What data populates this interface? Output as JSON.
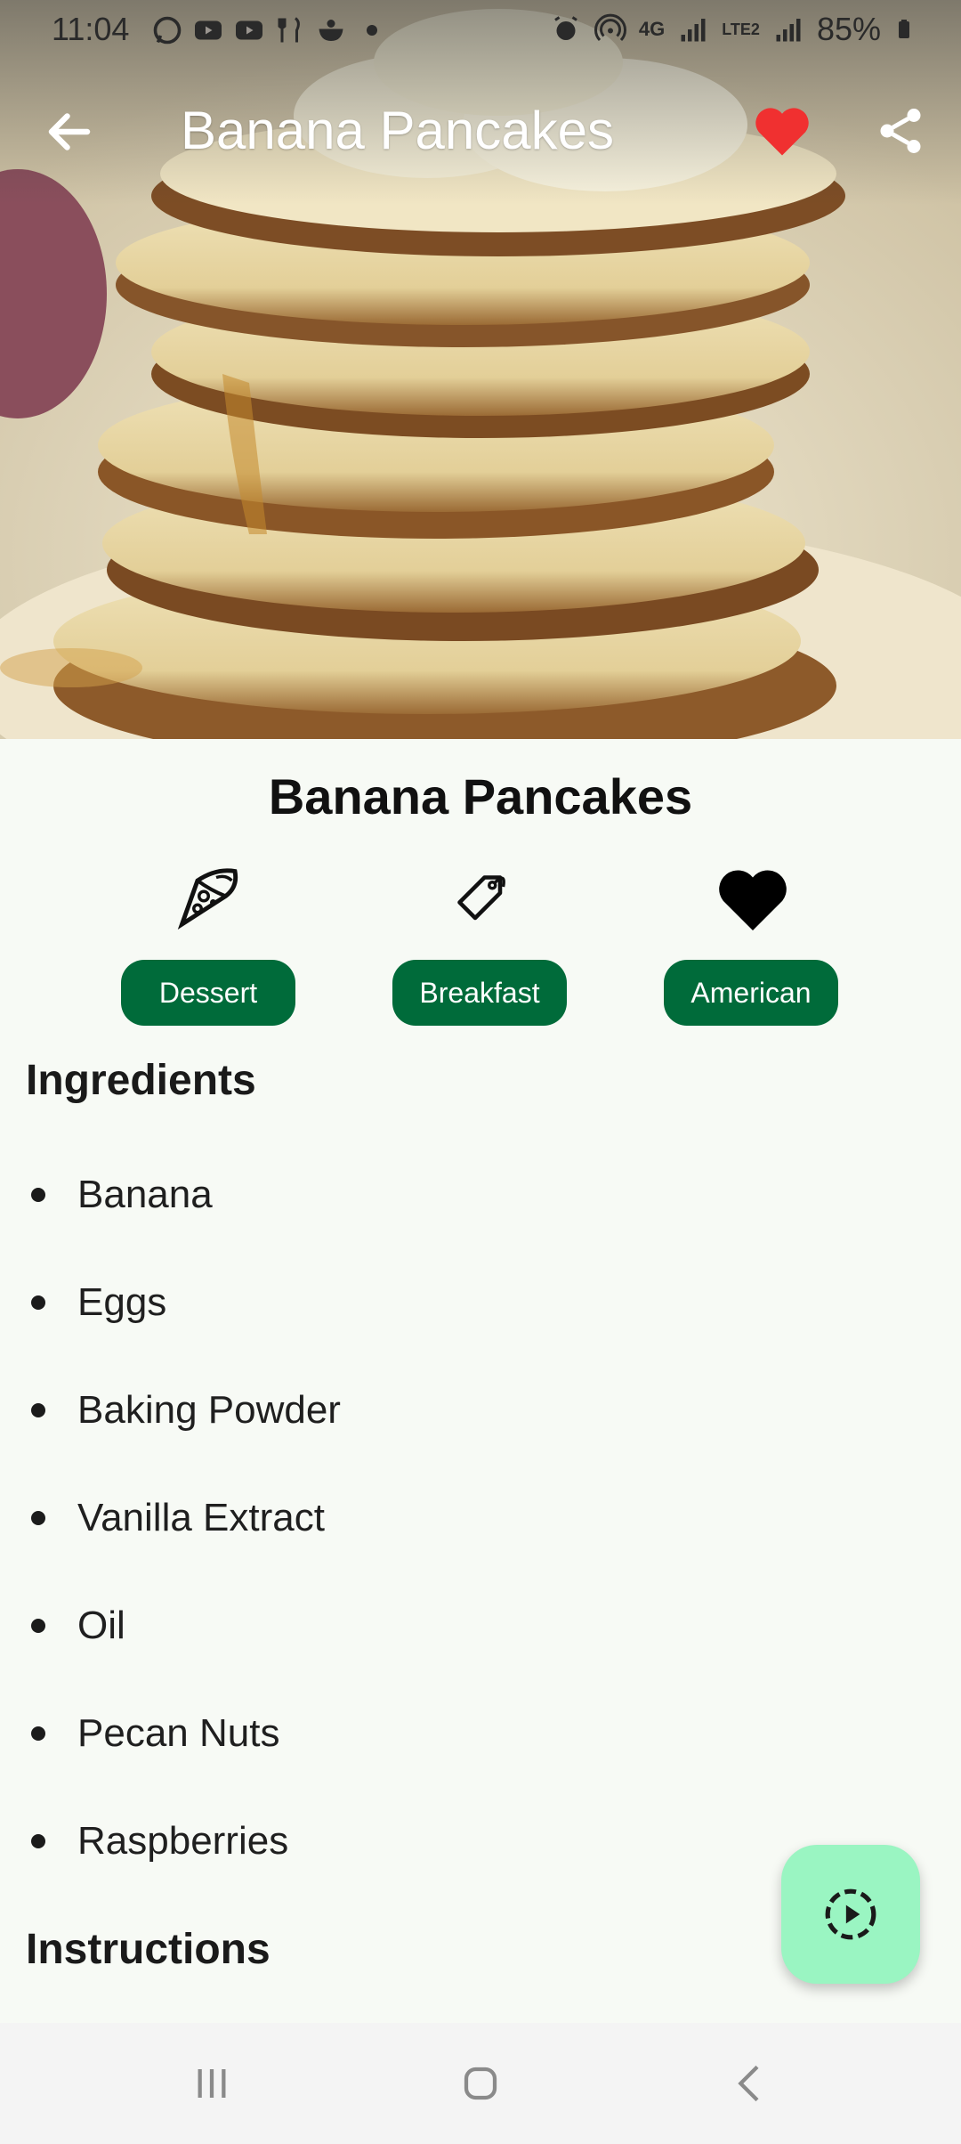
{
  "status_bar": {
    "time": "11:04",
    "battery": "85%",
    "network": "4G",
    "sim2_label": "LTE2",
    "icons": [
      "whatsapp-icon",
      "youtube-icon",
      "youtube-icon",
      "restaurant-icon",
      "bowl-icon",
      "dot-icon",
      "alarm-icon",
      "hotspot-icon",
      "signal-icon",
      "signal-icon",
      "battery-icon"
    ]
  },
  "app_bar": {
    "title": "Banana Pancakes",
    "favorite_color": "#f03030",
    "icons": [
      "back-arrow-icon",
      "heart-icon",
      "share-icon"
    ]
  },
  "recipe": {
    "title": "Banana Pancakes",
    "tags": [
      {
        "label": "Dessert",
        "icon": "pizza-icon"
      },
      {
        "label": "Breakfast",
        "icon": "tag-icon"
      },
      {
        "label": "American",
        "icon": "heart-icon"
      }
    ],
    "chip_color": "#006b3a",
    "ingredients_heading": "Ingredients",
    "ingredients": [
      "Banana",
      "Eggs",
      "Baking Powder",
      "Vanilla Extract",
      "Oil",
      "Pecan Nuts",
      "Raspberries"
    ],
    "instructions_heading": "Instructions"
  },
  "fab": {
    "icon": "play-circle-icon",
    "color": "#9af5c2"
  },
  "nav": {
    "icons": [
      "recents-icon",
      "home-icon",
      "back-icon"
    ]
  }
}
